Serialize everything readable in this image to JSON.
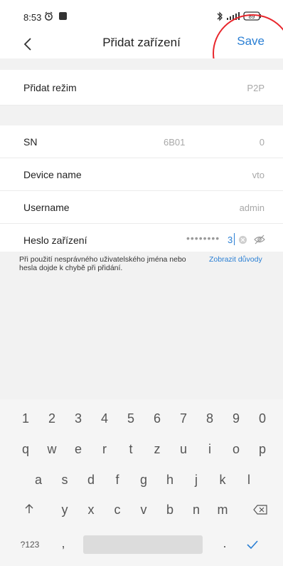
{
  "status_bar": {
    "time": "8:53",
    "battery": "89"
  },
  "title_bar": {
    "title": "Přidat zařízení",
    "save_label": "Save"
  },
  "form": {
    "mode": {
      "label": "Přidat režim",
      "value": "P2P"
    },
    "sn": {
      "label": "SN",
      "value_part1": "6B01",
      "value_part2": "0"
    },
    "device_name": {
      "label": "Device name",
      "value": "vto"
    },
    "username": {
      "label": "Username",
      "value": "admin"
    },
    "password": {
      "label": "Heslo zařízení",
      "masked_value": "••••••••",
      "last_char": "3"
    }
  },
  "hint": {
    "text": "Při použití nesprávného uživatelského jména nebo hesla dojde k chybě při přidání.",
    "link": "Zobrazit důvody"
  },
  "keyboard": {
    "row_numbers": [
      "1",
      "2",
      "3",
      "4",
      "5",
      "6",
      "7",
      "8",
      "9",
      "0"
    ],
    "row1": [
      "q",
      "w",
      "e",
      "r",
      "t",
      "z",
      "u",
      "i",
      "o",
      "p"
    ],
    "row2": [
      "a",
      "s",
      "d",
      "f",
      "g",
      "h",
      "j",
      "k",
      "l"
    ],
    "row3": [
      "y",
      "x",
      "c",
      "v",
      "b",
      "n",
      "m"
    ],
    "symbols_label": "?123",
    "comma": ",",
    "period": "."
  },
  "colors": {
    "accent": "#2a7fd4",
    "annotation": "#e8262c"
  },
  "icons": [
    "alarm-icon",
    "notification-icon",
    "bluetooth-icon",
    "signal-icon",
    "battery-icon",
    "back-arrow-icon",
    "clear-icon",
    "eye-hidden-icon",
    "shift-icon",
    "backspace-icon",
    "checkmark-icon"
  ]
}
